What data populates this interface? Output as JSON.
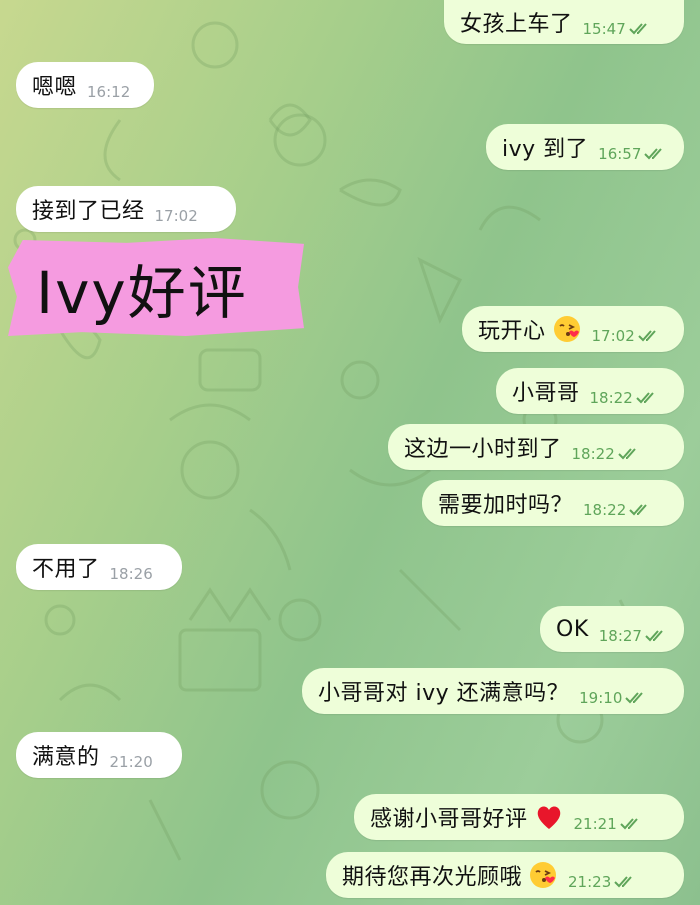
{
  "sticker": {
    "text": "Ivy好评"
  },
  "messages": [
    {
      "id": "m1",
      "dir": "out",
      "text": "女孩上车了",
      "time": "15:47"
    },
    {
      "id": "m2",
      "dir": "in",
      "text": "嗯嗯",
      "time": "16:12"
    },
    {
      "id": "m3",
      "dir": "out",
      "text": "ivy 到了",
      "time": "16:57"
    },
    {
      "id": "m4",
      "dir": "in",
      "text": "接到了已经",
      "time": "17:02"
    },
    {
      "id": "m5",
      "dir": "out",
      "text": "玩开心",
      "time": "17:02",
      "emoji": "kiss-face-emoji"
    },
    {
      "id": "m6",
      "dir": "out",
      "text": "小哥哥",
      "time": "18:22"
    },
    {
      "id": "m7",
      "dir": "out",
      "text": "这边一小时到了",
      "time": "18:22"
    },
    {
      "id": "m8",
      "dir": "out",
      "text": "需要加时吗？",
      "time": "18:22"
    },
    {
      "id": "m9",
      "dir": "in",
      "text": "不用了",
      "time": "18:26"
    },
    {
      "id": "m10",
      "dir": "out",
      "text": "OK",
      "time": "18:27"
    },
    {
      "id": "m11",
      "dir": "out",
      "text": "小哥哥对 ivy 还满意吗？",
      "time": "19:10"
    },
    {
      "id": "m12",
      "dir": "in",
      "text": "满意的",
      "time": "21:20"
    },
    {
      "id": "m13",
      "dir": "out",
      "text": "感谢小哥哥好评",
      "time": "21:21",
      "emoji": "red-heart-emoji"
    },
    {
      "id": "m14",
      "dir": "out",
      "text": "期待您再次光顾哦",
      "time": "21:23",
      "emoji": "kiss-face-emoji"
    }
  ],
  "colors": {
    "incoming": "#ffffff",
    "outgoing": "#eefed9",
    "sticker": "#f59be0",
    "read_check": "#5fa55a"
  }
}
